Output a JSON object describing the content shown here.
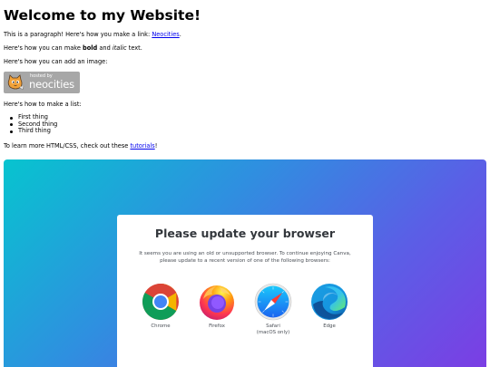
{
  "heading": "Welcome to my Website!",
  "para1": {
    "text": "This is a paragraph! Here's how you make a link: ",
    "link": "Neocities",
    "end": "."
  },
  "para2": {
    "before": "Here's how you can make ",
    "bold": "bold",
    "and": " and ",
    "italic": "italic",
    "after": " text."
  },
  "para3": "Here's how you can add an image:",
  "badge": {
    "small": "hosted by",
    "brand": "neocities"
  },
  "para4": "Here's how to make a list:",
  "list": [
    "First thing",
    "Second thing",
    "Third thing"
  ],
  "para5": {
    "before": "To learn more HTML/CSS, check out these ",
    "link": "tutorials",
    "after": "!"
  },
  "canva": {
    "title": "Please update your browser",
    "message_line1": "It seems you are using an old or unsupported browser. To continue enjoying Canva,",
    "message_line2": "please update to a recent version of one of the following browsers:",
    "browsers": [
      {
        "icon": "chrome-icon",
        "label": "Chrome"
      },
      {
        "icon": "firefox-icon",
        "label": "Firefox"
      },
      {
        "icon": "safari-icon",
        "label": "Safari\n(macOS only)"
      },
      {
        "icon": "edge-icon",
        "label": "Edge"
      }
    ]
  }
}
